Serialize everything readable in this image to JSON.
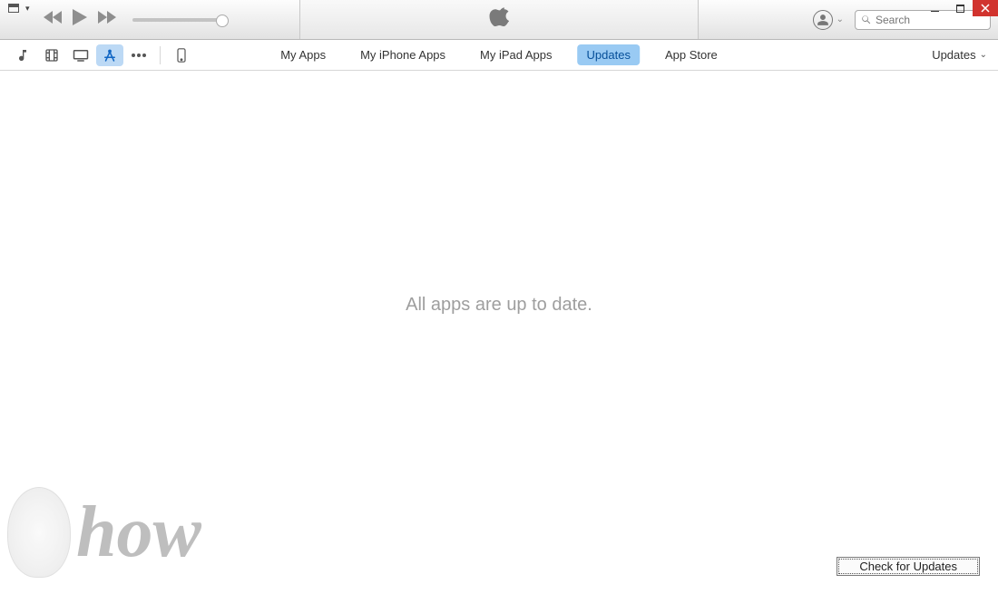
{
  "window_controls": {
    "minimize_tooltip": "Minimize",
    "maximize_tooltip": "Maximize",
    "close_tooltip": "Close"
  },
  "playback": {
    "prev": "Previous",
    "play": "Play",
    "next": "Next",
    "volume_percent": 100
  },
  "search": {
    "placeholder": "Search",
    "value": ""
  },
  "library_icons": [
    {
      "name": "music",
      "active": false
    },
    {
      "name": "movies",
      "active": false
    },
    {
      "name": "tv",
      "active": false
    },
    {
      "name": "apps",
      "active": true
    },
    {
      "name": "more",
      "active": false
    }
  ],
  "device_icon": "phone",
  "tabs": [
    {
      "label": "My Apps",
      "active": false
    },
    {
      "label": "My iPhone Apps",
      "active": false
    },
    {
      "label": "My iPad Apps",
      "active": false
    },
    {
      "label": "Updates",
      "active": true
    },
    {
      "label": "App Store",
      "active": false
    }
  ],
  "right_dropdown": {
    "label": "Updates"
  },
  "content": {
    "status_message": "All apps are up to date."
  },
  "buttons": {
    "check_updates": "Check for Updates"
  },
  "watermark": {
    "text": "how"
  }
}
